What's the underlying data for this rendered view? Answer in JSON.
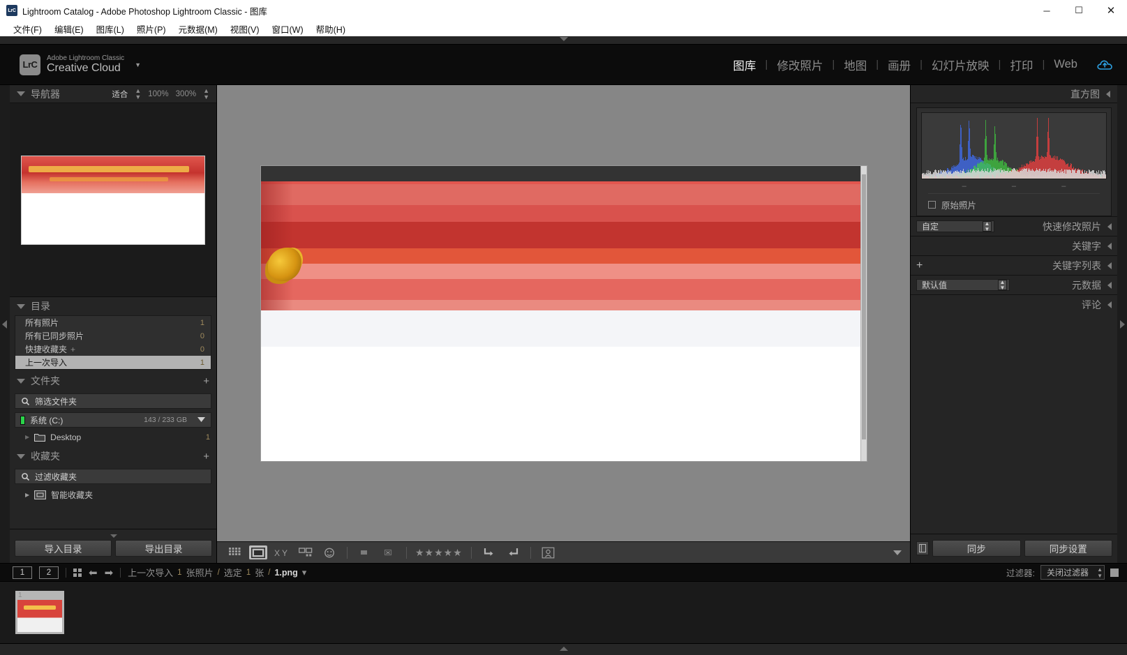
{
  "window": {
    "title": "Lightroom Catalog - Adobe Photoshop Lightroom Classic - 图库",
    "app_icon": "LrC",
    "minimize": "─",
    "maximize": "☐",
    "close": "✕"
  },
  "menubar": [
    {
      "label": "文件(F)"
    },
    {
      "label": "编辑(E)"
    },
    {
      "label": "图库(L)"
    },
    {
      "label": "照片(P)"
    },
    {
      "label": "元数据(M)"
    },
    {
      "label": "视图(V)"
    },
    {
      "label": "窗口(W)"
    },
    {
      "label": "帮助(H)"
    }
  ],
  "identity": {
    "badge": "LrC",
    "line1": "Adobe Lightroom Classic",
    "line2": "Creative Cloud",
    "caret": "▼"
  },
  "modules": [
    {
      "label": "图库",
      "active": true
    },
    {
      "label": "修改照片",
      "active": false
    },
    {
      "label": "地图",
      "active": false
    },
    {
      "label": "画册",
      "active": false
    },
    {
      "label": "幻灯片放映",
      "active": false
    },
    {
      "label": "打印",
      "active": false
    },
    {
      "label": "Web",
      "active": false
    }
  ],
  "left_panel": {
    "navigator": {
      "title": "导航器",
      "fit": "适合",
      "zoom_100": "100%",
      "zoom_300": "300%"
    },
    "catalog": {
      "title": "目录",
      "items": [
        {
          "label": "所有照片",
          "count": "1",
          "selected": false
        },
        {
          "label": "所有已同步照片",
          "count": "0",
          "selected": false
        },
        {
          "label": "快捷收藏夹",
          "count": "0",
          "selected": false,
          "plus": "+"
        },
        {
          "label": "上一次导入",
          "count": "1",
          "selected": true
        }
      ]
    },
    "folders": {
      "title": "文件夹",
      "add": "+",
      "filter_placeholder": "筛选文件夹",
      "volume": {
        "name": "系统 (C:)",
        "capacity": "143 / 233 GB"
      },
      "items": [
        {
          "label": "Desktop",
          "count": "1"
        }
      ]
    },
    "collections": {
      "title": "收藏夹",
      "add": "+",
      "filter_placeholder": "过滤收藏夹",
      "items": [
        {
          "label": "智能收藏夹"
        }
      ]
    },
    "buttons": {
      "import": "导入目录",
      "export": "导出目录"
    }
  },
  "right_panel": {
    "histogram": {
      "title": "直方图",
      "original_label": "原始照片",
      "ticks": [
        "–",
        "–",
        "–"
      ]
    },
    "sections": [
      {
        "label": "快速修改照片",
        "select_value": "自定",
        "has_select": true,
        "has_plus": false
      },
      {
        "label": "关键字",
        "select_value": "",
        "has_select": false,
        "has_plus": false
      },
      {
        "label": "关键字列表",
        "select_value": "",
        "has_select": false,
        "has_plus": true,
        "plus": "+"
      },
      {
        "label": "元数据",
        "select_value": "默认值",
        "has_select": true,
        "has_plus": false
      },
      {
        "label": "评论",
        "select_value": "",
        "has_select": false,
        "has_plus": false
      }
    ],
    "buttons": {
      "sync": "同步",
      "sync_settings": "同步设置"
    }
  },
  "toolbar": {
    "icons": [
      {
        "name": "grid-view-icon",
        "active": false
      },
      {
        "name": "loupe-view-icon",
        "active": true
      },
      {
        "name": "compare-view-icon",
        "active": false
      },
      {
        "name": "survey-view-icon",
        "active": false
      },
      {
        "name": "people-view-icon",
        "active": false
      },
      {
        "name": "flag-pick-icon",
        "active": false
      },
      {
        "name": "flag-reject-icon",
        "active": false
      },
      {
        "name": "rotate-left-icon",
        "active": false
      },
      {
        "name": "rotate-right-icon",
        "active": false
      },
      {
        "name": "crop-overlay-icon",
        "active": false
      }
    ],
    "rating": "★★★★★"
  },
  "filmstrip": {
    "screen_1": "1",
    "screen_2": "2",
    "back_arrow": "⬅",
    "forward_arrow": "➡",
    "source": "上一次导入",
    "photo_count": "1",
    "photo_count_unit": "张照片",
    "separator": "/",
    "selected_label": "选定",
    "selected_count": "1",
    "selected_unit": "张",
    "filename": "1.png",
    "caret": "▾",
    "filter_label": "过滤器:",
    "filter_value": "关闭过滤器",
    "thumb_index": "1"
  },
  "chart_data": {
    "type": "area",
    "title": "直方图",
    "xlabel": "",
    "ylabel": "",
    "series": [
      {
        "name": "red",
        "color": "#ff4040"
      },
      {
        "name": "green",
        "color": "#40d040"
      },
      {
        "name": "blue",
        "color": "#4070ff"
      },
      {
        "name": "luminance",
        "color": "#d8d8d8"
      }
    ],
    "peaks": [
      {
        "channel": "blue",
        "position": 0.21,
        "height": 0.95
      },
      {
        "channel": "blue",
        "position": 0.255,
        "height": 0.98
      },
      {
        "channel": "green",
        "position": 0.345,
        "height": 0.92
      },
      {
        "channel": "green",
        "position": 0.395,
        "height": 0.88
      },
      {
        "channel": "red",
        "position": 0.625,
        "height": 0.93
      },
      {
        "channel": "red",
        "position": 0.685,
        "height": 0.97
      }
    ]
  }
}
